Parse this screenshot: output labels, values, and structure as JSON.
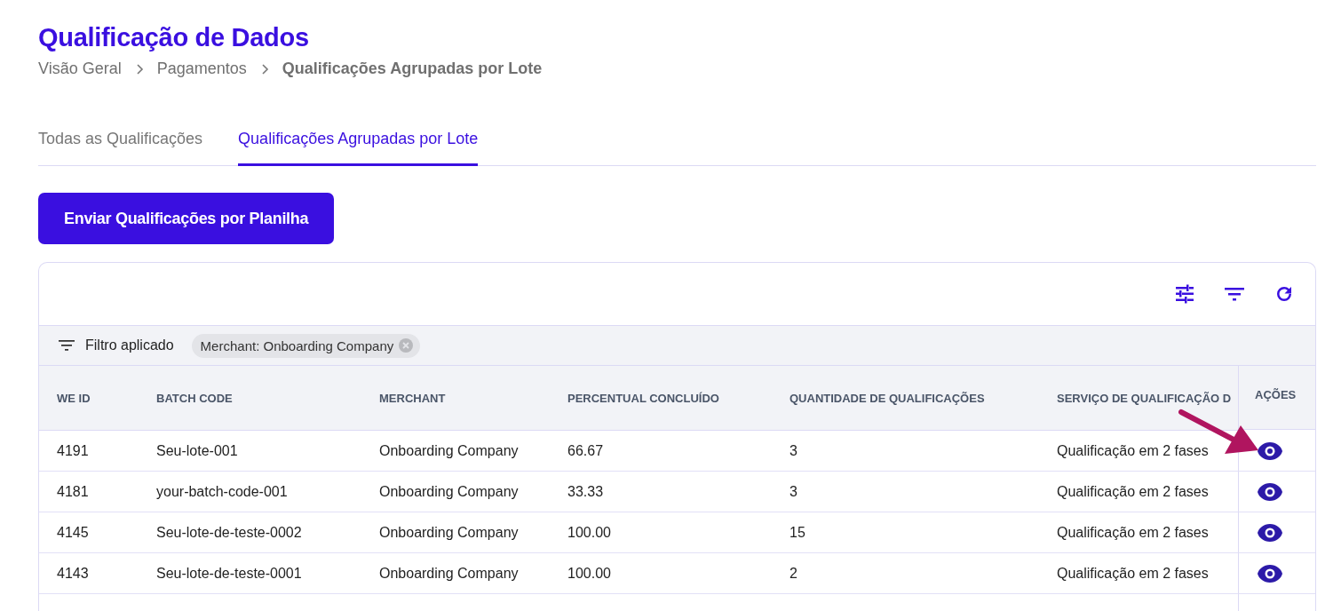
{
  "page": {
    "title": "Qualificação de Dados"
  },
  "breadcrumb": [
    {
      "label": "Visão Geral",
      "current": false
    },
    {
      "label": "Pagamentos",
      "current": false
    },
    {
      "label": "Qualificações Agrupadas por Lote",
      "current": true
    }
  ],
  "tabs": [
    {
      "label": "Todas as Qualificações",
      "selected": false
    },
    {
      "label": "Qualificações Agrupadas por Lote",
      "selected": true
    }
  ],
  "upload_button": "Enviar Qualificações por Planilha",
  "filter_bar": {
    "label": "Filtro aplicado",
    "chips": [
      "Merchant: Onboarding Company"
    ]
  },
  "table": {
    "columns": [
      "WE ID",
      "BATCH CODE",
      "MERCHANT",
      "PERCENTUAL CONCLUÍDO",
      "QUANTIDADE DE QUALIFICAÇÕES",
      "SERVIÇO DE QUALIFICAÇÃO D",
      "AÇÕES"
    ],
    "rows": [
      {
        "cells": [
          "4191",
          "Seu-lote-001",
          "Onboarding Company",
          "66.67",
          "3",
          "Qualificação em 2 fases"
        ],
        "highlighted": true
      },
      {
        "cells": [
          "4181",
          "your-batch-code-001",
          "Onboarding Company",
          "33.33",
          "3",
          "Qualificação em 2 fases"
        ],
        "highlighted": false
      },
      {
        "cells": [
          "4145",
          "Seu-lote-de-teste-0002",
          "Onboarding Company",
          "100.00",
          "15",
          "Qualificação em 2 fases"
        ],
        "highlighted": false
      },
      {
        "cells": [
          "4143",
          "Seu-lote-de-teste-0001",
          "Onboarding Company",
          "100.00",
          "2",
          "Qualificação em 2 fases"
        ],
        "highlighted": false
      }
    ]
  }
}
